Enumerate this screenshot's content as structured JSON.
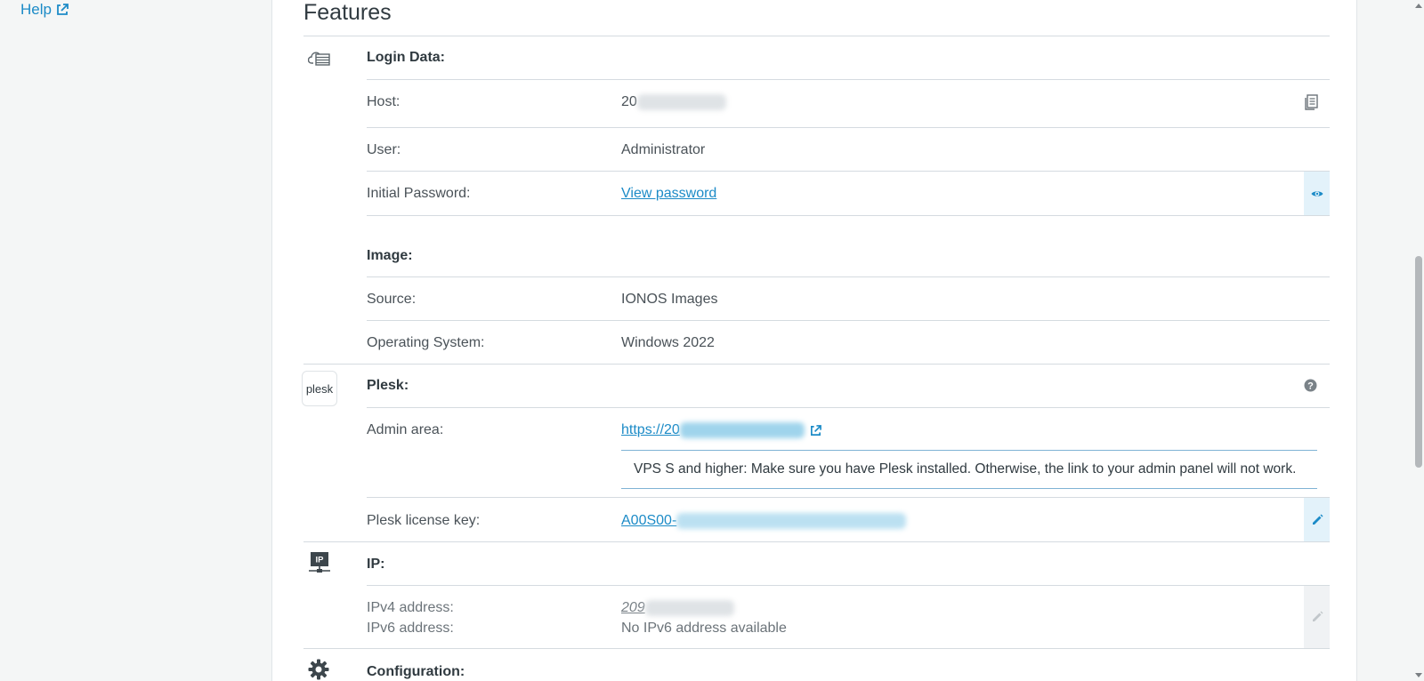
{
  "sidebar": {
    "help_label": "Help"
  },
  "features": {
    "title": "Features",
    "login_data": {
      "title": "Login Data:",
      "host_label": "Host:",
      "host_value": "20",
      "user_label": "User:",
      "user_value": "Administrator",
      "password_label": "Initial Password:",
      "password_link": "View password"
    },
    "image": {
      "title": "Image:",
      "source_label": "Source:",
      "source_value": "IONOS Images",
      "os_label": "Operating System:",
      "os_value": "Windows 2022"
    },
    "plesk": {
      "logo_text": "plesk",
      "title": "Plesk:",
      "admin_label": "Admin area:",
      "admin_link": "https://20",
      "info_text": "VPS S and higher: Make sure you have Plesk installed. Otherwise, the link to your admin panel will not work.",
      "license_label": "Plesk license key:",
      "license_value": "A00S00-"
    },
    "ip": {
      "title": "IP:",
      "ipv4_label": "IPv4 address:",
      "ipv4_value": "209",
      "ipv6_label": "IPv6 address:",
      "ipv6_value": "No IPv6 address available"
    },
    "configuration": {
      "title": "Configuration:"
    }
  },
  "colors": {
    "accent": "#1c8bc7",
    "action_bg": "#e3f2fa",
    "icon_gray": "#7a8288"
  },
  "icons": [
    "external-link-icon",
    "cloud-server-icon",
    "copy-icon",
    "eye-icon",
    "help-icon",
    "edit-icon",
    "ip-network-icon",
    "gear-icon"
  ]
}
